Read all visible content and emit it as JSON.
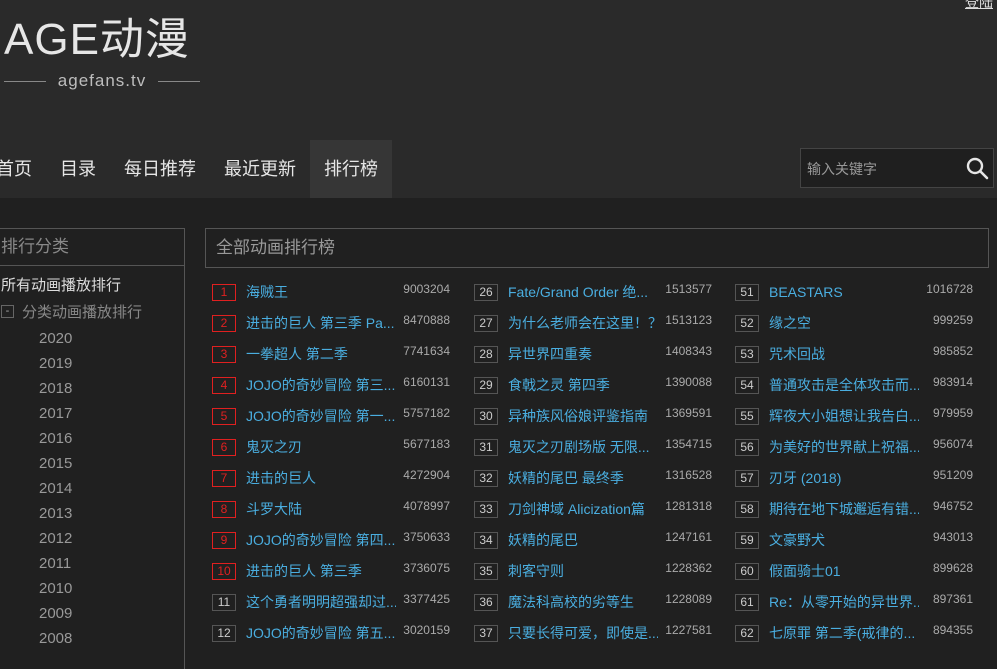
{
  "header": {
    "logo_main": "AGE动漫",
    "logo_sub": "agefans.tv",
    "login": "登陆"
  },
  "nav": {
    "items": [
      "首页",
      "目录",
      "每日推荐",
      "最近更新",
      "排行榜"
    ],
    "active_index": 4
  },
  "search": {
    "placeholder": "输入关键字"
  },
  "sidebar": {
    "title": "排行分类",
    "all": "所有动画播放排行",
    "category": "分类动画播放排行",
    "years": [
      "2020",
      "2019",
      "2018",
      "2017",
      "2016",
      "2015",
      "2014",
      "2013",
      "2012",
      "2011",
      "2010",
      "2009",
      "2008"
    ]
  },
  "main": {
    "title": "全部动画排行榜"
  },
  "rankings": [
    [
      {
        "rank": "1",
        "title": "海贼王",
        "count": "9003204"
      },
      {
        "rank": "2",
        "title": "进击的巨人 第三季 Pa...",
        "count": "8470888"
      },
      {
        "rank": "3",
        "title": "一拳超人 第二季",
        "count": "7741634"
      },
      {
        "rank": "4",
        "title": "JOJO的奇妙冒险 第三...",
        "count": "6160131"
      },
      {
        "rank": "5",
        "title": "JOJO的奇妙冒险 第一...",
        "count": "5757182"
      },
      {
        "rank": "6",
        "title": "鬼灭之刃",
        "count": "5677183"
      },
      {
        "rank": "7",
        "title": "进击的巨人",
        "count": "4272904"
      },
      {
        "rank": "8",
        "title": "斗罗大陆",
        "count": "4078997"
      },
      {
        "rank": "9",
        "title": "JOJO的奇妙冒险 第四...",
        "count": "3750633"
      },
      {
        "rank": "10",
        "title": "进击的巨人 第三季",
        "count": "3736075"
      },
      {
        "rank": "11",
        "title": "这个勇者明明超强却过...",
        "count": "3377425"
      },
      {
        "rank": "12",
        "title": "JOJO的奇妙冒险 第五...",
        "count": "3020159"
      }
    ],
    [
      {
        "rank": "26",
        "title": "Fate/Grand Order 绝...",
        "count": "1513577"
      },
      {
        "rank": "27",
        "title": "为什么老师会在这里！？",
        "count": "1513123"
      },
      {
        "rank": "28",
        "title": "异世界四重奏",
        "count": "1408343"
      },
      {
        "rank": "29",
        "title": "食戟之灵 第四季",
        "count": "1390088"
      },
      {
        "rank": "30",
        "title": "异种族风俗娘评鉴指南",
        "count": "1369591"
      },
      {
        "rank": "31",
        "title": "鬼灭之刃剧场版 无限...",
        "count": "1354715"
      },
      {
        "rank": "32",
        "title": "妖精的尾巴 最终季",
        "count": "1316528"
      },
      {
        "rank": "33",
        "title": "刀剑神域 Alicization篇",
        "count": "1281318"
      },
      {
        "rank": "34",
        "title": "妖精的尾巴",
        "count": "1247161"
      },
      {
        "rank": "35",
        "title": "刺客守则",
        "count": "1228362"
      },
      {
        "rank": "36",
        "title": "魔法科高校的劣等生",
        "count": "1228089"
      },
      {
        "rank": "37",
        "title": "只要长得可爱，即使是...",
        "count": "1227581"
      }
    ],
    [
      {
        "rank": "51",
        "title": "BEASTARS",
        "count": "1016728"
      },
      {
        "rank": "52",
        "title": "缘之空",
        "count": "999259"
      },
      {
        "rank": "53",
        "title": "咒术回战",
        "count": "985852"
      },
      {
        "rank": "54",
        "title": "普通攻击是全体攻击而...",
        "count": "983914"
      },
      {
        "rank": "55",
        "title": "辉夜大小姐想让我告白...",
        "count": "979959"
      },
      {
        "rank": "56",
        "title": "为美好的世界献上祝福...",
        "count": "956074"
      },
      {
        "rank": "57",
        "title": "刃牙 (2018)",
        "count": "951209"
      },
      {
        "rank": "58",
        "title": "期待在地下城邂逅有错...",
        "count": "946752"
      },
      {
        "rank": "59",
        "title": "文豪野犬",
        "count": "943013"
      },
      {
        "rank": "60",
        "title": "假面骑士01",
        "count": "899628"
      },
      {
        "rank": "61",
        "title": "Re：从零开始的异世界...",
        "count": "897361"
      },
      {
        "rank": "62",
        "title": "七原罪 第二季(戒律的...",
        "count": "894355"
      }
    ]
  ],
  "colors": {
    "background": "#202020",
    "header": "#2a2a2a",
    "link": "#4aaee0",
    "top_rank": "#e02020"
  }
}
